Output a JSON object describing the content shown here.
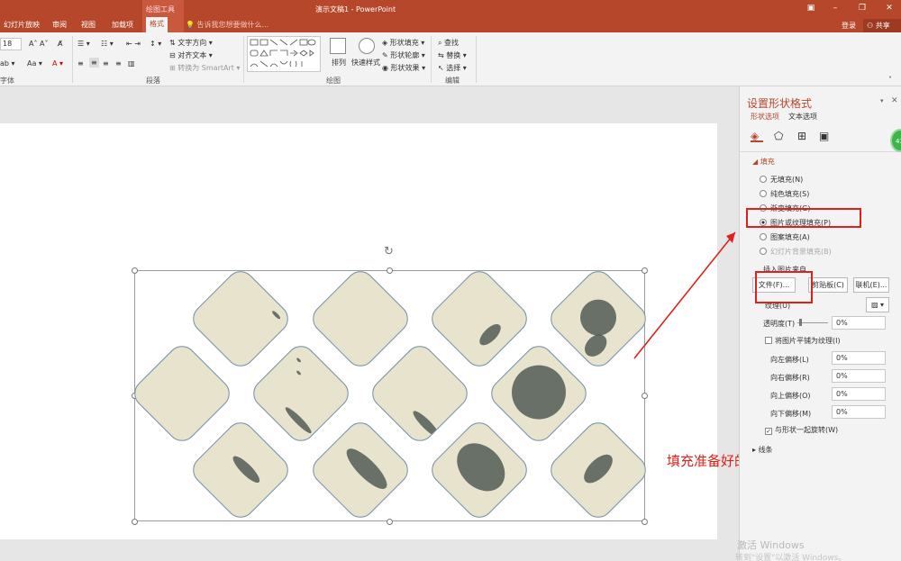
{
  "window": {
    "doc_title": "演示文稿1 - PowerPoint",
    "contextual_group": "绘图工具",
    "tell_me": "告诉我您想要做什么...",
    "login": "登录",
    "share": "共享"
  },
  "tabs": [
    "幻灯片放映",
    "审阅",
    "视图",
    "加载项",
    "格式"
  ],
  "ribbon": {
    "font_size": "18",
    "font_label": "字体",
    "paragraph_label": "段落",
    "drawing_label": "绘图",
    "editing_label": "编辑",
    "text_direction": "文字方向",
    "align_text": "对齐文本",
    "convert_smartart": "转换为 SmartArt",
    "arrange": "排列",
    "quick_styles": "快速样式",
    "shape_fill": "形状填充",
    "shape_outline": "形状轮廓",
    "shape_effects": "形状效果",
    "find": "查找",
    "replace": "替换",
    "select": "选择"
  },
  "pane": {
    "title": "设置形状格式",
    "tabs": [
      "形状选项",
      "文本选项"
    ],
    "fill_section": "填充",
    "options": [
      "无填充(N)",
      "纯色填充(S)",
      "渐变填充(G)",
      "图片或纹理填充(P)",
      "图案填充(A)",
      "幻灯片背景填充(B)"
    ],
    "insert_from": "插入图片来自",
    "btn_file": "文件(F)...",
    "btn_clipboard": "剪贴板(C)",
    "btn_online": "联机(E)...",
    "texture": "纹理(U)",
    "transparency": "透明度(T)",
    "transparency_value": "0%",
    "tile_as_texture": "将图片平铺为纹理(I)",
    "offset_left": "向左偏移(L)",
    "offset_left_value": "0%",
    "offset_right": "向右偏移(R)",
    "offset_right_value": "0%",
    "offset_top": "向上偏移(O)",
    "offset_top_value": "0%",
    "offset_bottom": "向下偏移(M)",
    "offset_bottom_value": "0%",
    "rotate_with_shape": "与形状一起旋转(W)",
    "line_section": "线条"
  },
  "annotation": "填充准备好的素材古风图",
  "watermark": "激活 Windows",
  "watermark_sub": "转到\"设置\"以激活 Windows。",
  "badge": "43",
  "colors": {
    "accent": "#b7472a",
    "annotation_red": "#e0211b"
  }
}
